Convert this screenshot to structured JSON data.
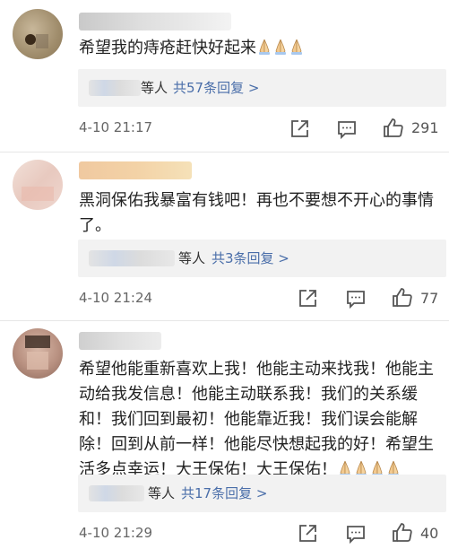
{
  "comments": [
    {
      "text": "希望我的痔疮赶快好起来",
      "emoji_count": 3,
      "reply_etc": "等人",
      "reply_count": "共57条回复 >",
      "time": "4-10 21:17",
      "likes": "291"
    },
    {
      "text": "黑洞保佑我暴富有钱吧！再也不要想不开心的事情了。",
      "emoji_count": 0,
      "reply_etc": "等人",
      "reply_count": "共3条回复 >",
      "time": "4-10 21:24",
      "likes": "77"
    },
    {
      "text": "希望他能重新喜欢上我！他能主动来找我！他能主动给我发信息！他能主动联系我！我们的关系缓和！我们回到最初！他能靠近我！我们误会能解除！回到从前一样！他能尽快想起我的好！希望生活多点幸运！大王保佑！大王保佑！",
      "emoji_count": 4,
      "reply_etc": "等人",
      "reply_count": "共17条回复 >",
      "time": "4-10 21:29",
      "likes": "40"
    }
  ],
  "icons": {
    "share": "share-icon",
    "comment": "comment-icon",
    "like": "thumbs-up-icon",
    "emoji": "folded-hands-emoji"
  },
  "colors": {
    "link_blue": "#4a6ea9",
    "reply_bg": "#f2f2f2",
    "time_gray": "#666666"
  }
}
